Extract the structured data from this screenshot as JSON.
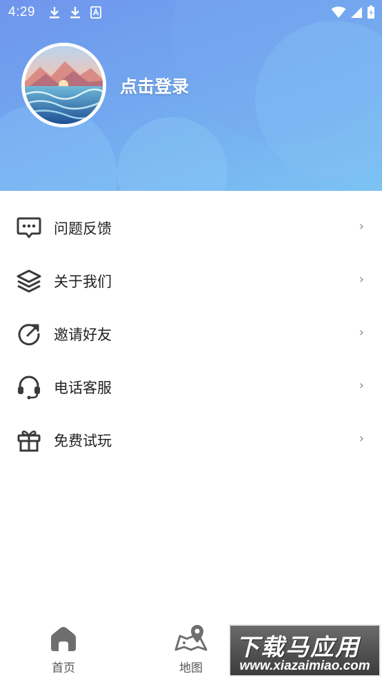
{
  "status_bar": {
    "time": "4:29"
  },
  "header": {
    "login_text": "点击登录"
  },
  "menu": {
    "items": [
      {
        "label": "问题反馈",
        "icon": "feedback-icon",
        "chevron": "›"
      },
      {
        "label": "关于我们",
        "icon": "layers-icon",
        "chevron": "›"
      },
      {
        "label": "邀请好友",
        "icon": "share-icon",
        "chevron": "›"
      },
      {
        "label": "电话客服",
        "icon": "headset-icon",
        "chevron": "›"
      },
      {
        "label": "免费试玩",
        "icon": "gift-icon",
        "chevron": "›"
      }
    ]
  },
  "tabbar": {
    "tabs": [
      {
        "label": "首页",
        "icon": "home-icon"
      },
      {
        "label": "地图",
        "icon": "map-icon"
      }
    ]
  },
  "watermark": {
    "top": "下载马应用",
    "bottom": "www.xiazaimiao.com"
  },
  "colors": {
    "header_gradient_start": "#6f95ec",
    "header_gradient_end": "#7cc3f3",
    "icon_gray": "#555555",
    "text_dark": "#222222"
  }
}
